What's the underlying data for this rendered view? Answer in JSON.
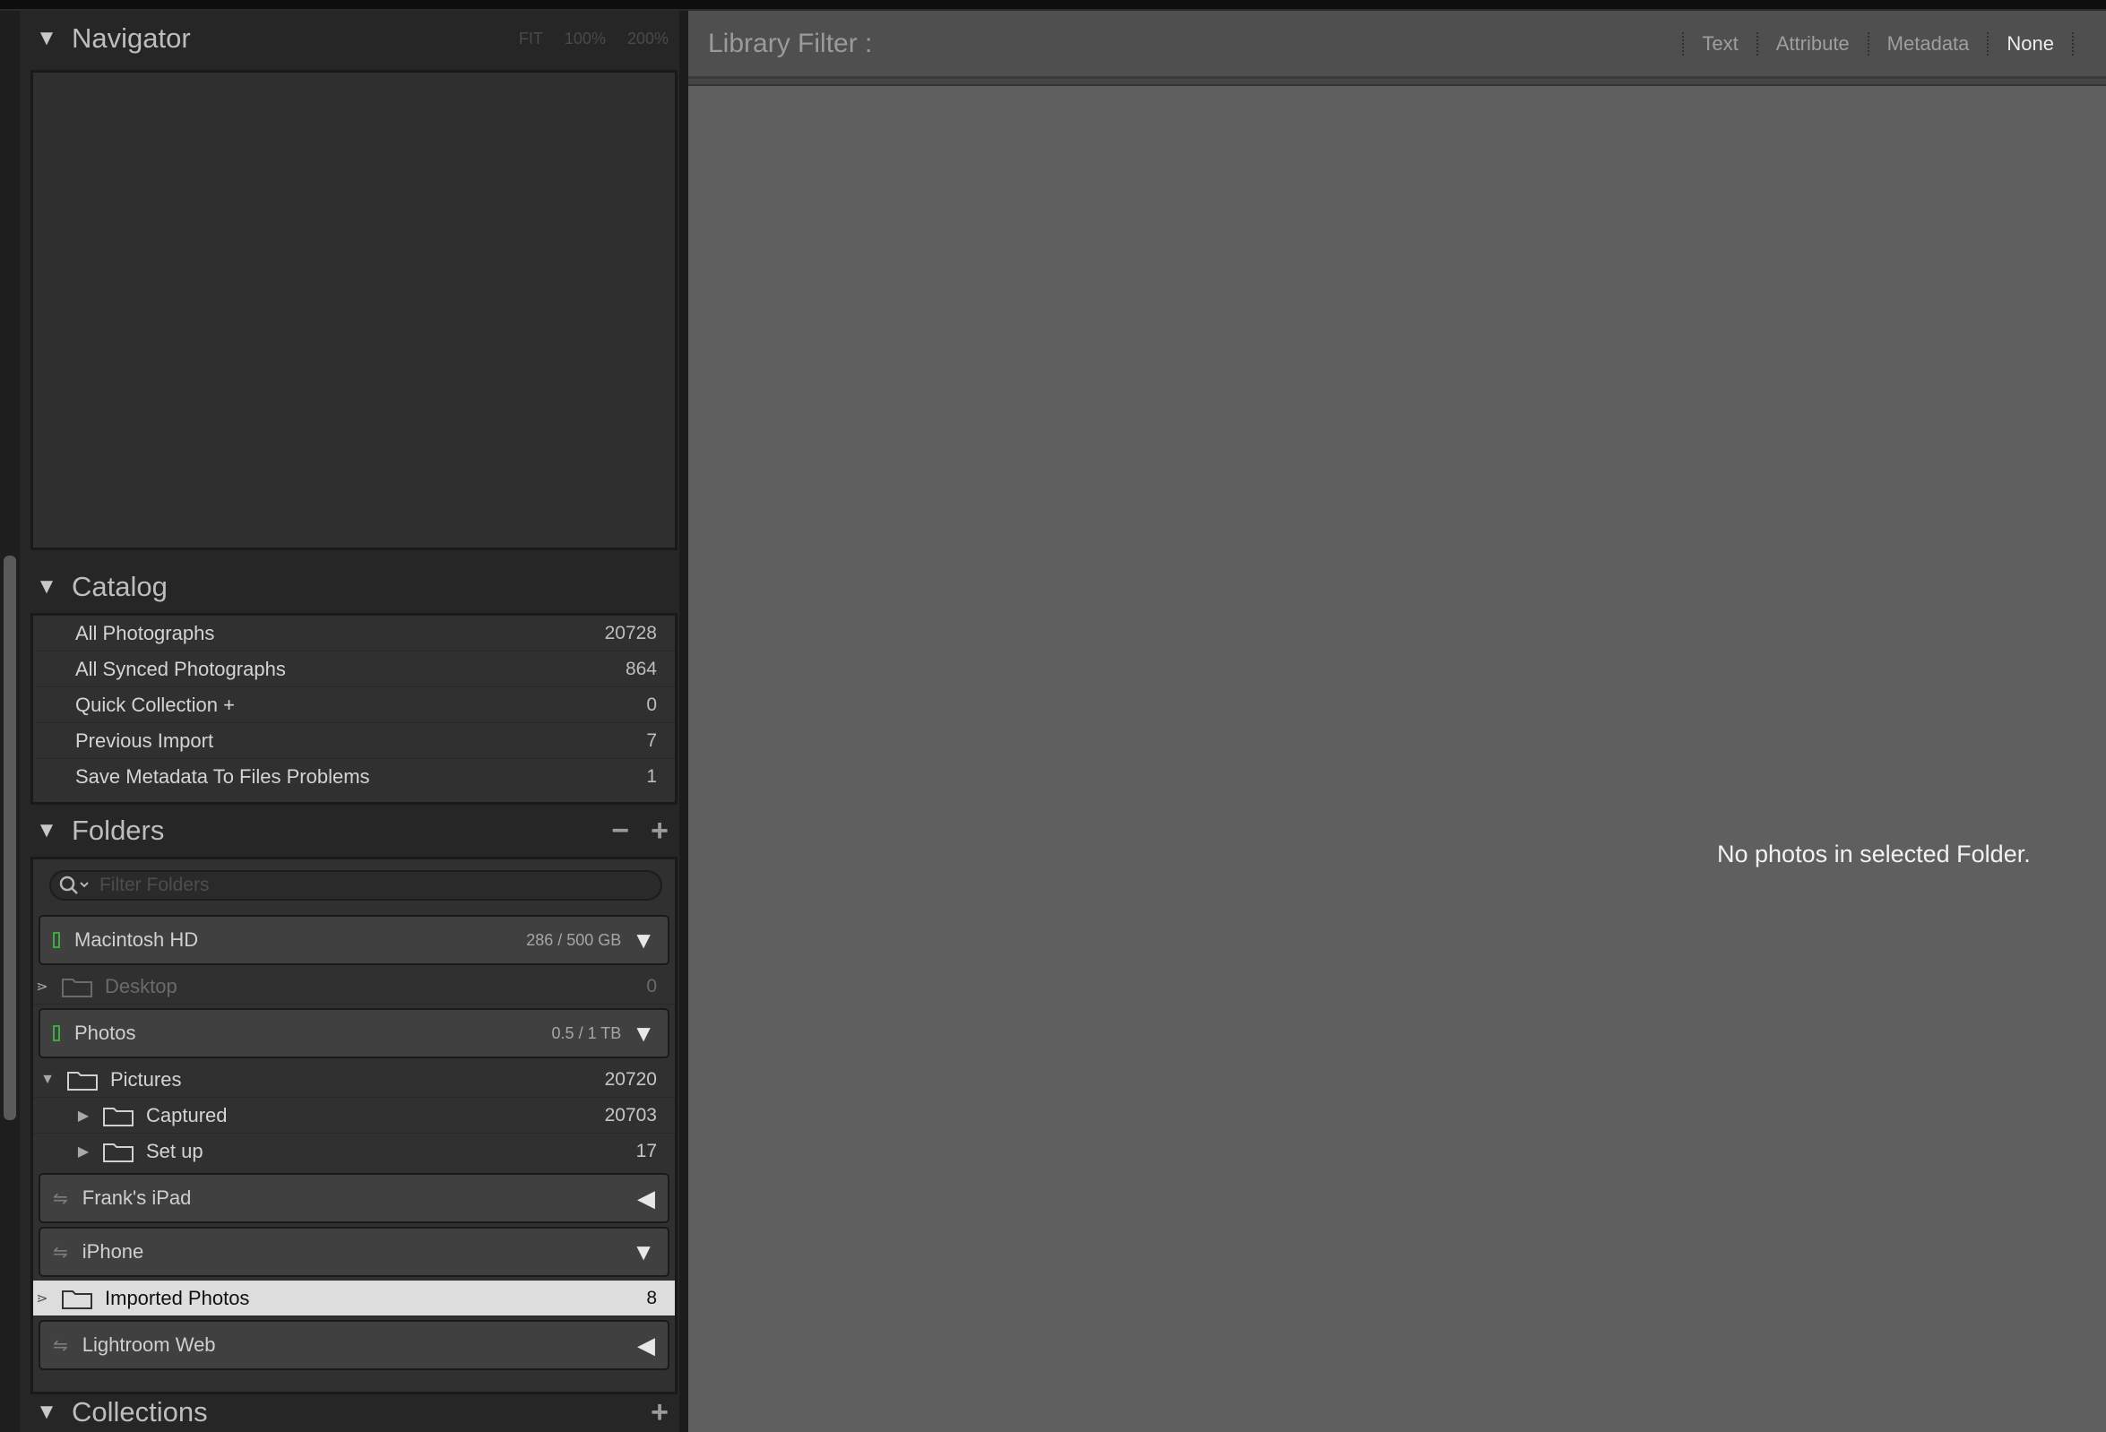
{
  "navigator": {
    "title": "Navigator",
    "zoom_options": [
      "FIT",
      "100%",
      "200%"
    ]
  },
  "catalog": {
    "title": "Catalog",
    "items": [
      {
        "label": "All Photographs",
        "count": "20728"
      },
      {
        "label": "All Synced Photographs",
        "count": "864"
      },
      {
        "label": "Quick Collection +",
        "count": "0"
      },
      {
        "label": "Previous Import",
        "count": "7"
      },
      {
        "label": "Save Metadata To Files Problems",
        "count": "1"
      }
    ]
  },
  "folders": {
    "title": "Folders",
    "minus": "−",
    "plus": "+",
    "filter_placeholder": "Filter Folders",
    "volumes": {
      "macintosh": {
        "label": "Macintosh HD",
        "size": "286 / 500 GB"
      },
      "photos": {
        "label": "Photos",
        "size": "0.5 / 1 TB"
      },
      "ipad": {
        "label": "Frank's iPad"
      },
      "iphone": {
        "label": "iPhone"
      },
      "web": {
        "label": "Lightroom Web"
      }
    },
    "desktop": {
      "label": "Desktop",
      "count": "0"
    },
    "pictures": {
      "label": "Pictures",
      "count": "20720"
    },
    "captured": {
      "label": "Captured",
      "count": "20703"
    },
    "setup": {
      "label": "Set up",
      "count": "17"
    },
    "imported": {
      "label": "Imported Photos",
      "count": "8"
    }
  },
  "collections": {
    "title": "Collections",
    "plus": "+"
  },
  "library_filter": {
    "title": "Library Filter :",
    "options": [
      "Text",
      "Attribute",
      "Metadata",
      "None"
    ],
    "active": "None"
  },
  "main": {
    "empty_message": "No photos in selected Folder."
  },
  "colors": {
    "panel": "#262626",
    "main_bg": "#5f5f5f",
    "selected_row": "#dddddd",
    "volume_indicator": "#3faa3f"
  }
}
